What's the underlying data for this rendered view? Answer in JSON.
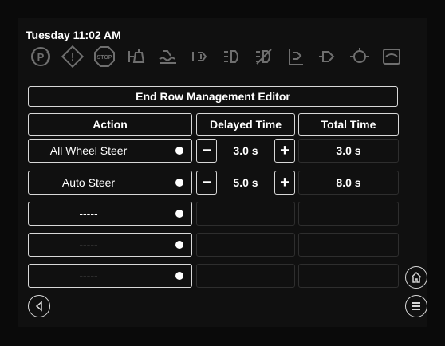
{
  "status_bar": {
    "clock": "Tuesday 11:02 AM",
    "icons": [
      {
        "name": "park-brake-icon",
        "glyph": "(P)"
      },
      {
        "name": "warning-icon",
        "glyph": "!"
      },
      {
        "name": "stop-icon",
        "glyph": "STOP"
      },
      {
        "name": "hitch-icon",
        "glyph": "hitch"
      },
      {
        "name": "fluid-level-icon",
        "glyph": "fluid"
      },
      {
        "name": "turn-signal-icon",
        "glyph": "turn"
      },
      {
        "name": "lights-icon",
        "glyph": "lights"
      },
      {
        "name": "lights-off-icon",
        "glyph": "lights-off"
      },
      {
        "name": "steering-icon",
        "glyph": "steer"
      },
      {
        "name": "hydraulic-icon",
        "glyph": "hydraulic"
      },
      {
        "name": "engine-icon",
        "glyph": "engine"
      },
      {
        "name": "radar-icon",
        "glyph": "radar"
      }
    ]
  },
  "editor": {
    "title": "End Row Management Editor",
    "headers": {
      "action": "Action",
      "delayed": "Delayed Time",
      "total": "Total Time"
    },
    "rows": [
      {
        "action": "All Wheel Steer",
        "delayed": "3.0 s",
        "total": "3.0 s",
        "minus": "−",
        "plus": "+"
      },
      {
        "action": "Auto Steer",
        "delayed": "5.0 s",
        "total": "8.0 s",
        "minus": "−",
        "plus": "+"
      },
      {
        "action": "-----"
      },
      {
        "action": "-----"
      },
      {
        "action": "-----"
      }
    ]
  },
  "nav": {
    "home": "home-icon",
    "back": "back-icon",
    "menu": "menu-icon"
  },
  "colors": {
    "background": "#101010",
    "border": "#d8d8d8",
    "icon_inactive": "#6f6f6f"
  }
}
